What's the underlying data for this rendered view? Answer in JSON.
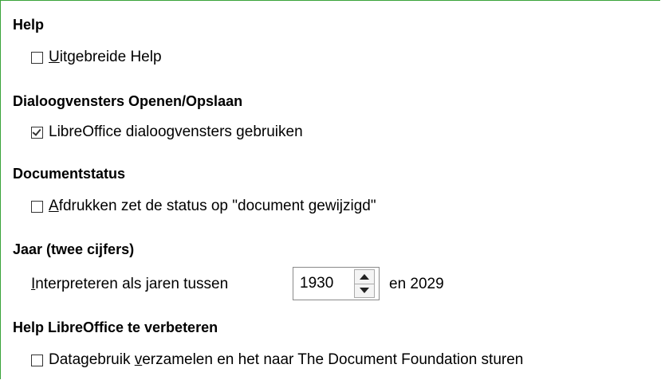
{
  "sections": {
    "help": {
      "title": "Help",
      "option": {
        "prefix": "",
        "mnemonic": "U",
        "rest": "itgebreide Help",
        "checked": false
      }
    },
    "dialogs": {
      "title": "Dialoogvensters Openen/Opslaan",
      "option": {
        "prefix": "LibreOffice dialoogvensters ",
        "mnemonic": "g",
        "rest": "ebruiken",
        "checked": true
      }
    },
    "docstatus": {
      "title": "Documentstatus",
      "option": {
        "prefix": "",
        "mnemonic": "A",
        "rest": "fdrukken zet de status op \"document gewijzigd\"",
        "checked": false
      }
    },
    "year": {
      "title": "Jaar (twee cijfers)",
      "label_mnemonic": "I",
      "label_rest": "nterpreteren als jaren tussen",
      "start_year": "1930",
      "end_text": "en 2029"
    },
    "improve": {
      "title": "Help LibreOffice te verbeteren",
      "option": {
        "prefix": "Datagebruik ",
        "mnemonic": "v",
        "rest": "erzamelen en het naar The Document Foundation sturen",
        "checked": false
      }
    }
  }
}
